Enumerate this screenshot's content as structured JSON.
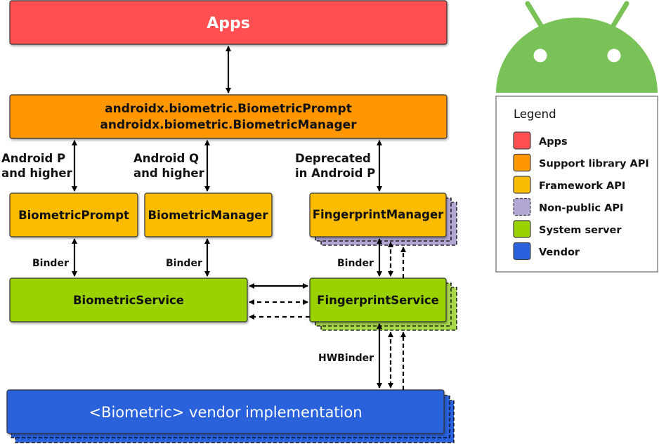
{
  "colors": {
    "apps": "#ff4f51",
    "support_library": "#ff9800",
    "framework": "#fbbc04",
    "non_public": "#b3a6d4",
    "system_server": "#9ad200",
    "system_server_shadow": "#a8d84a",
    "vendor": "#2962dc",
    "android_logo": "#78c257"
  },
  "boxes": {
    "apps": "Apps",
    "support_line1": "androidx.biometric.BiometricPrompt",
    "support_line2": "androidx.biometric.BiometricManager",
    "biometric_prompt": "BiometricPrompt",
    "biometric_manager": "BiometricManager",
    "fingerprint_manager": "FingerprintManager",
    "biometric_service": "BiometricService",
    "fingerprint_service": "FingerprintService",
    "vendor": "<Biometric> vendor implementation"
  },
  "labels": {
    "android_p_1": "Android P",
    "android_p_2": "and higher",
    "android_q_1": "Android Q",
    "android_q_2": "and higher",
    "deprecated_1": "Deprecated",
    "deprecated_2": "in Android P",
    "binder_prompt": "Binder",
    "binder_manager": "Binder",
    "binder_fingerprint": "Binder",
    "hwbinder": "HWBinder"
  },
  "legend": {
    "title": "Legend",
    "items": [
      {
        "label": "Apps",
        "color": "#ff4f51",
        "dashed": false
      },
      {
        "label": "Support library API",
        "color": "#ff9800",
        "dashed": false
      },
      {
        "label": "Framework API",
        "color": "#fbbc04",
        "dashed": false
      },
      {
        "label": "Non-public API",
        "color": "#b3a6d4",
        "dashed": true
      },
      {
        "label": "System server",
        "color": "#9ad200",
        "dashed": false
      },
      {
        "label": "Vendor",
        "color": "#2962dc",
        "dashed": false
      }
    ]
  }
}
